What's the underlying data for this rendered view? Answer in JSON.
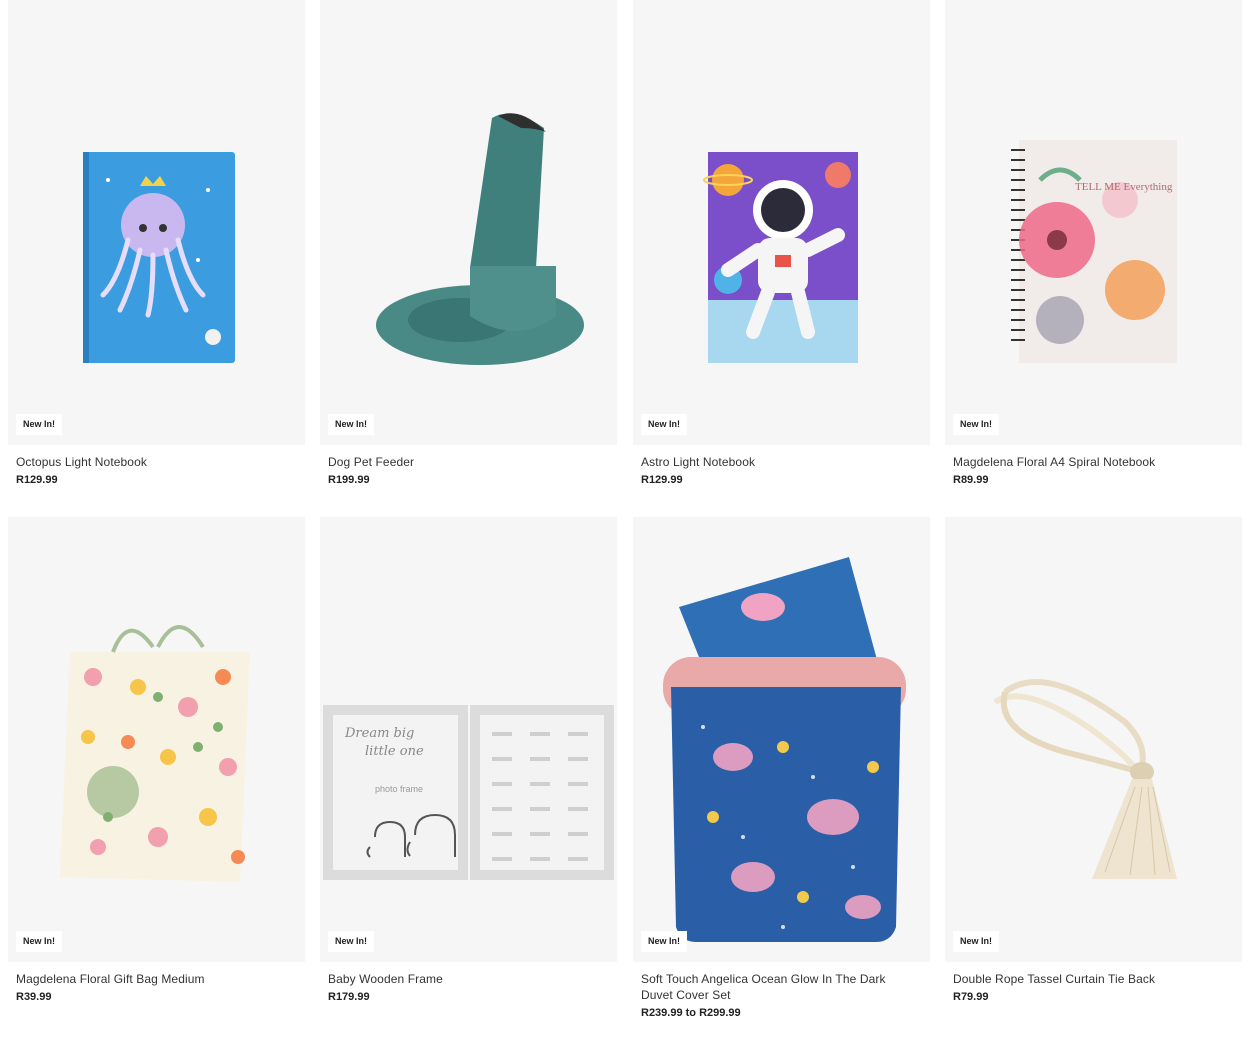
{
  "products": [
    {
      "title": "Octopus Light Notebook",
      "price": "R129.99",
      "badge": "New In!",
      "icon": "jellyfish-notebook-image"
    },
    {
      "title": "Dog Pet Feeder",
      "price": "R199.99",
      "badge": "New In!",
      "icon": "pet-feeder-image"
    },
    {
      "title": "Astro Light Notebook",
      "price": "R129.99",
      "badge": "New In!",
      "icon": "astronaut-notebook-image"
    },
    {
      "title": "Magdelena Floral A4 Spiral Notebook",
      "price": "R89.99",
      "badge": "New In!",
      "icon": "floral-spiral-notebook-image",
      "cover_text": "TELL ME Everything"
    },
    {
      "title": "Magdelena Floral Gift Bag Medium",
      "price": "R39.99",
      "badge": "New In!",
      "icon": "floral-gift-bag-image"
    },
    {
      "title": "Baby Wooden Frame",
      "price": "R179.99",
      "badge": "New In!",
      "icon": "baby-frame-image",
      "frame_text_1": "Dream big",
      "frame_text_2": "little one",
      "frame_text_3": "photo frame"
    },
    {
      "title": "Soft Touch Angelica Ocean Glow In The Dark Duvet Cover Set",
      "price": "R239.99 to R299.99",
      "badge": "New In!",
      "icon": "ocean-duvet-image"
    },
    {
      "title": "Double Rope Tassel Curtain Tie Back",
      "price": "R79.99",
      "badge": "New In!",
      "icon": "rope-tassel-image"
    }
  ]
}
